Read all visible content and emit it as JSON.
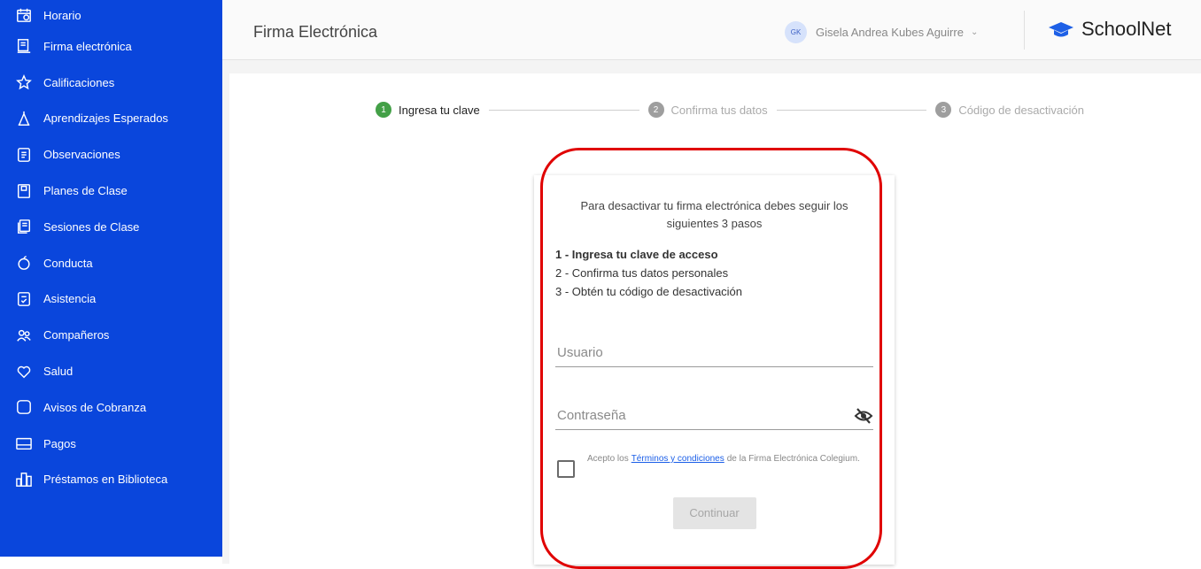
{
  "sidebar": {
    "items": [
      {
        "label": "Horario",
        "icon": "calendar-icon"
      },
      {
        "label": "Firma electrónica",
        "icon": "signature-icon"
      },
      {
        "label": "Calificaciones",
        "icon": "star-icon"
      },
      {
        "label": "Aprendizajes Esperados",
        "icon": "compass-icon"
      },
      {
        "label": "Observaciones",
        "icon": "note-icon"
      },
      {
        "label": "Planes de Clase",
        "icon": "plan-icon"
      },
      {
        "label": "Sesiones de Clase",
        "icon": "sessions-icon"
      },
      {
        "label": "Conducta",
        "icon": "apple-icon"
      },
      {
        "label": "Asistencia",
        "icon": "attendance-icon"
      },
      {
        "label": "Compañeros",
        "icon": "people-icon"
      },
      {
        "label": "Salud",
        "icon": "heart-icon"
      },
      {
        "label": "Avisos de Cobranza",
        "icon": "square-icon"
      },
      {
        "label": "Pagos",
        "icon": "card-icon"
      },
      {
        "label": "Préstamos en Biblioteca",
        "icon": "library-icon"
      }
    ]
  },
  "header": {
    "title": "Firma Electrónica",
    "user_initials": "GK",
    "user_name": "Gisela Andrea Kubes Aguirre",
    "brand": "SchoolNet"
  },
  "stepper": {
    "steps": [
      {
        "number": "1",
        "label": "Ingresa tu clave",
        "state": "active"
      },
      {
        "number": "2",
        "label": "Confirma tus datos",
        "state": "inactive"
      },
      {
        "number": "3",
        "label": "Código de desactivación",
        "state": "inactive"
      }
    ]
  },
  "card": {
    "intro": "Para desactivar tu firma electrónica debes seguir los siguientes 3 pasos",
    "step1": "1 - Ingresa tu clave de acceso",
    "step2": "2 - Confirma tus datos personales",
    "step3": "3 - Obtén tu código de desactivación",
    "usuario_placeholder": "Usuario",
    "password_placeholder": "Contraseña",
    "terms_prefix": "Acepto los",
    "terms_link": "Términos y condiciones",
    "terms_suffix": "de la Firma Electrónica Colegium.",
    "continue_label": "Continuar"
  },
  "colors": {
    "sidebar_bg": "#0a46dc",
    "active_step": "#43a047",
    "highlight": "#e00000"
  }
}
